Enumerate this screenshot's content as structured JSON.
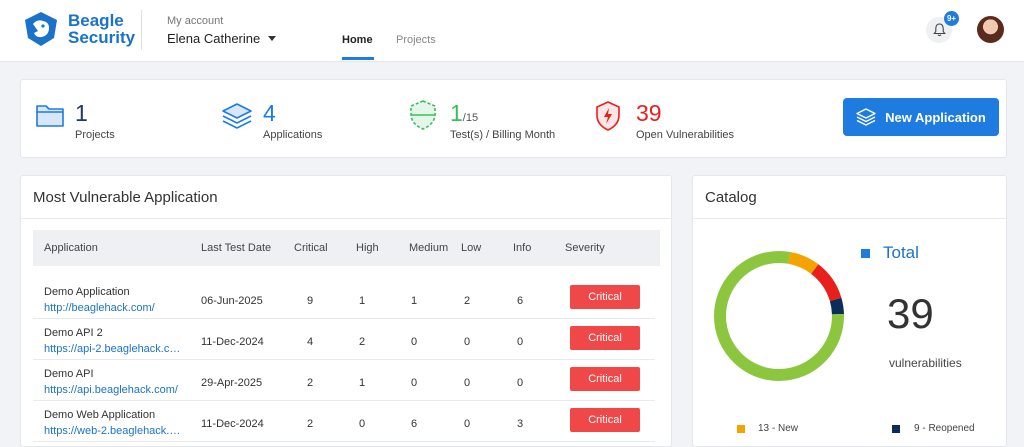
{
  "header": {
    "brand_line1": "Beagle",
    "brand_line2": "Security",
    "account_label": "My account",
    "account_name": "Elena Catherine",
    "tabs": [
      {
        "label": "Home",
        "active": true
      },
      {
        "label": "Projects",
        "active": false
      }
    ],
    "notification_count": "9+"
  },
  "stats": {
    "projects": {
      "value": "1",
      "label": "Projects"
    },
    "applications": {
      "value": "4",
      "label": "Applications"
    },
    "tests": {
      "value": "1",
      "sub": "/15",
      "label": "Test(s) / Billing Month"
    },
    "vulnerabilities": {
      "value": "39",
      "label": "Open Vulnerabilities"
    },
    "new_app_label": "New Application"
  },
  "colors": {
    "accent": "#1e7be0",
    "green": "#3bbf5c",
    "red": "#e8201c",
    "critical": "#f04848"
  },
  "vulnerable": {
    "title": "Most Vulnerable Application",
    "columns": [
      "Application",
      "Last Test Date",
      "Critical",
      "High",
      "Medium",
      "Low",
      "Info",
      "Severity"
    ],
    "rows": [
      {
        "name": "Demo Application",
        "url": "http://beaglehack.com/",
        "date": "06-Jun-2025",
        "critical": "9",
        "high": "1",
        "medium": "1",
        "low": "2",
        "info": "6",
        "severity": "Critical"
      },
      {
        "name": "Demo API 2",
        "url": "https://api-2.beaglehack.co...",
        "date": "11-Dec-2024",
        "critical": "4",
        "high": "2",
        "medium": "0",
        "low": "0",
        "info": "0",
        "severity": "Critical"
      },
      {
        "name": "Demo API",
        "url": "https://api.beaglehack.com/",
        "date": "29-Apr-2025",
        "critical": "2",
        "high": "1",
        "medium": "0",
        "low": "0",
        "info": "0",
        "severity": "Critical"
      },
      {
        "name": "Demo Web Application",
        "url": "https://web-2.beaglehack.c...",
        "date": "11-Dec-2024",
        "critical": "2",
        "high": "0",
        "medium": "6",
        "low": "0",
        "info": "3",
        "severity": "Critical"
      }
    ]
  },
  "catalog": {
    "title": "Catalog",
    "total_label": "Total",
    "total_value": "39",
    "unit_label": "vulnerabilities",
    "legend": [
      {
        "label": "13 - New",
        "color": "#f5a300"
      },
      {
        "label": "9 - Reopened",
        "color": "#0b2d5a"
      }
    ],
    "donut": [
      {
        "value": 31,
        "color": "#8cc63f"
      },
      {
        "value": 3,
        "color": "#f5a300"
      },
      {
        "value": 4,
        "color": "#e8201c"
      },
      {
        "value": 1.6,
        "color": "#0b2d5a"
      }
    ]
  }
}
